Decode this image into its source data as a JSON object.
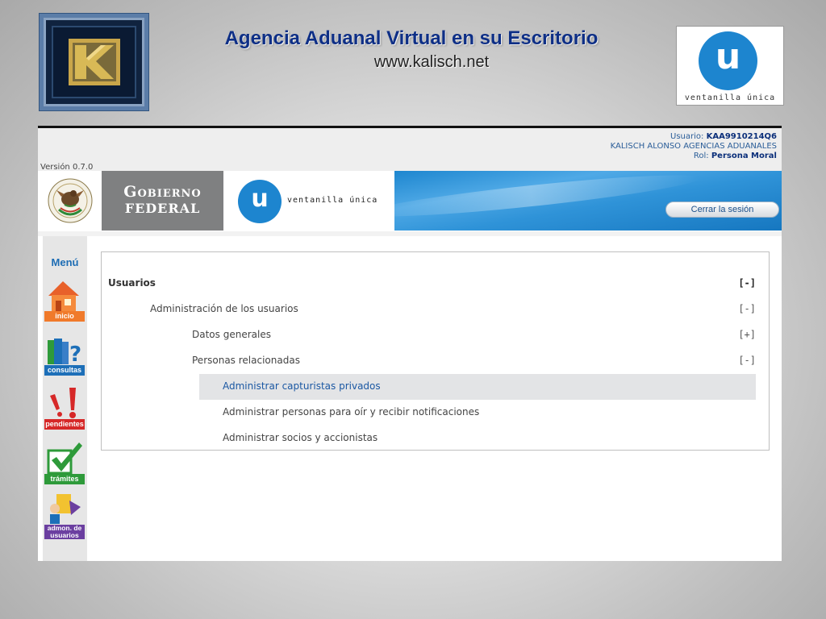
{
  "slide": {
    "title": "Agencia Aduanal Virtual en su Escritorio",
    "url": "www.kalisch.net",
    "vu_logo_letter": "u",
    "vu_logo_caption": "ventanilla única"
  },
  "header": {
    "version": "Versión 0.7.0",
    "user_label": "Usuario:",
    "user_id": "KAA9910214Q6",
    "company": "KALISCH ALONSO AGENCIAS ADUANALES",
    "role_label": "Rol:",
    "role": "Persona Moral"
  },
  "banner": {
    "gobierno_line1": "Gobierno",
    "gobierno_line2": "FEDERAL",
    "vu_letter": "u",
    "vu_caption": "ventanilla única",
    "logout_label": "Cerrar la sesión"
  },
  "menu": {
    "title": "Menú",
    "items": [
      {
        "label": "inicio",
        "icon": "house-icon",
        "color": "#f07a2b"
      },
      {
        "label": "consultas",
        "icon": "book-question-icon",
        "color": "#1d6fb8"
      },
      {
        "label": "pendientes",
        "icon": "exclamation-icon",
        "color": "#d62828"
      },
      {
        "label": "trámites",
        "icon": "checkmark-icon",
        "color": "#2e9a3a"
      },
      {
        "label": "admon. de usuarios",
        "icon": "user-admin-icon",
        "color": "#6b3fa0"
      }
    ]
  },
  "tree": {
    "rows": [
      {
        "label": "Usuarios",
        "toggle": "[-]"
      },
      {
        "label": "Administración de los usuarios",
        "toggle": "[-]"
      },
      {
        "label": "Datos generales",
        "toggle": "[+]"
      },
      {
        "label": "Personas relacionadas",
        "toggle": "[-]"
      },
      {
        "label": "Administrar capturistas privados"
      },
      {
        "label": "Administrar personas para oír y recibir notificaciones"
      },
      {
        "label": "Administrar socios y accionistas"
      }
    ]
  },
  "colors": {
    "accent_blue": "#1d85cf",
    "title_navy": "#0e2f86",
    "gobierno_gray": "#7f8081"
  }
}
